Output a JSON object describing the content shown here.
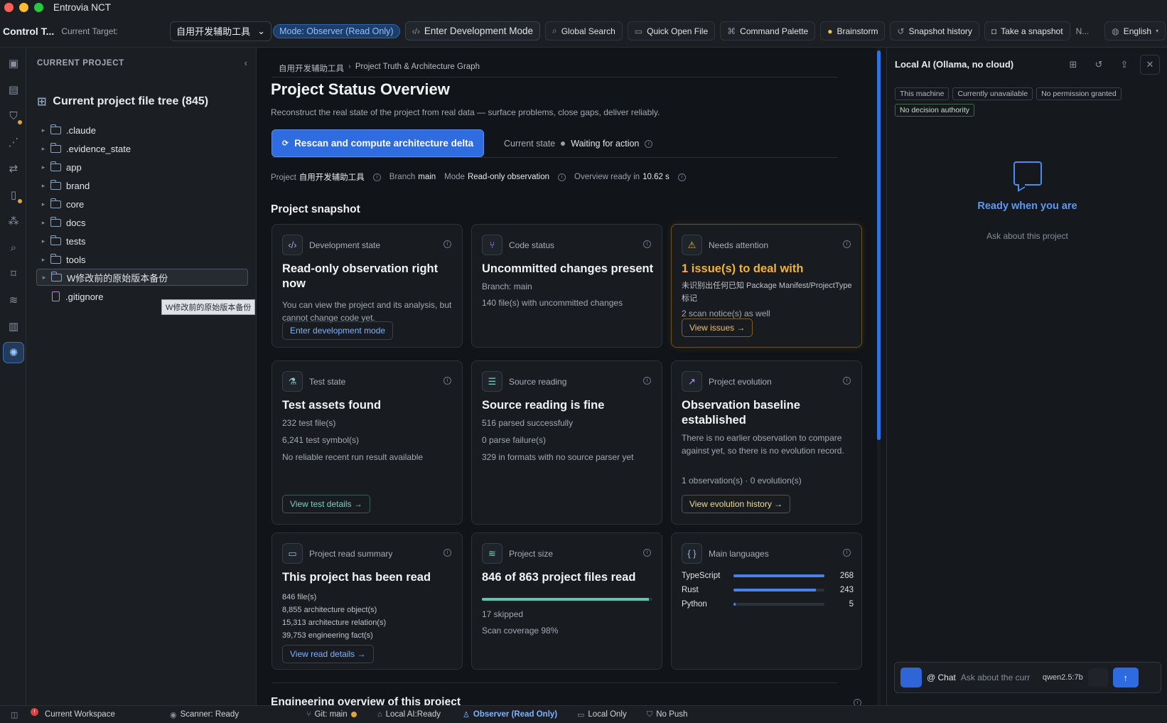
{
  "window": {
    "title": "Entrovia NCT"
  },
  "toolbar": {
    "brand": "Control T...",
    "target_label": "Current Target:",
    "target_value": "自用开发辅助工具",
    "mode_badge": "Mode: Observer (Read Only)",
    "dev_mode": "Enter Development Mode",
    "global_search": "Global Search",
    "quick_open": "Quick Open File",
    "command_palette": "Command Palette",
    "brainstorm": "Brainstorm",
    "snapshot_history": "Snapshot history",
    "take_snapshot": "Take a snapshot",
    "overflow": "N...",
    "language": "English"
  },
  "sidebar": {
    "heading": "CURRENT PROJECT",
    "tree_title": "Current project file tree (845)",
    "items": [
      {
        "label": ".claude",
        "kind": "folder"
      },
      {
        "label": ".evidence_state",
        "kind": "folder"
      },
      {
        "label": "app",
        "kind": "folder"
      },
      {
        "label": "brand",
        "kind": "folder"
      },
      {
        "label": "core",
        "kind": "folder"
      },
      {
        "label": "docs",
        "kind": "folder"
      },
      {
        "label": "tests",
        "kind": "folder"
      },
      {
        "label": "tools",
        "kind": "folder"
      },
      {
        "label": "W修改前的原始版本备份",
        "kind": "folder"
      },
      {
        "label": ".gitignore",
        "kind": "file"
      }
    ],
    "tooltip": "W修改前的原始版本备份"
  },
  "main": {
    "breadcrumb": [
      "自用开发辅助工具",
      "Project Truth & Architecture Graph"
    ],
    "title": "Project Status Overview",
    "subtitle": "Reconstruct the real state of the project from real data — surface problems, close gaps, deliver reliably.",
    "rescan_button": "Rescan and compute architecture delta",
    "state_label": "Current state",
    "state_value": "Waiting for action",
    "meta": {
      "project_label": "Project",
      "project_value": "自用开发辅助工具",
      "branch_label": "Branch",
      "branch_value": "main",
      "mode_label": "Mode",
      "mode_value": "Read-only observation",
      "ready_label": "Overview ready in",
      "ready_value": "10.62 s"
    },
    "snapshot_title": "Project snapshot",
    "engineering_title": "Engineering overview of this project",
    "cards": {
      "dev": {
        "label": "Development state",
        "title": "Read-only observation right now",
        "line1": "You can view the project and its analysis, but cannot change code yet.",
        "button": "Enter development mode"
      },
      "code": {
        "label": "Code status",
        "title": "Uncommitted changes present",
        "line1": "Branch: main",
        "line2": "140 file(s) with uncommitted changes"
      },
      "attention": {
        "label": "Needs attention",
        "title": "1 issue(s) to deal with",
        "line1": "未识别出任何已知 Package Manifest/ProjectType 标记",
        "line2": "2 scan notice(s) as well",
        "button": "View issues →"
      },
      "test": {
        "label": "Test state",
        "title": "Test assets found",
        "line1": "232 test file(s)",
        "line2": "6,241 test symbol(s)",
        "line3": "No reliable recent run result available",
        "button": "View test details →"
      },
      "source": {
        "label": "Source reading",
        "title": "Source reading is fine",
        "line1": "516 parsed successfully",
        "line2": "0 parse failure(s)",
        "line3": "329 in formats with no source parser yet"
      },
      "evolution": {
        "label": "Project evolution",
        "title": "Observation baseline established",
        "line1": "There is no earlier observation to compare against yet, so there is no evolution record.",
        "line2": "1 observation(s) · 0 evolution(s)",
        "button": "View evolution history →"
      },
      "read": {
        "label": "Project read summary",
        "title": "This project has been read",
        "line1": "846 file(s)",
        "line2": "8,855 architecture object(s)",
        "line3": "15,313 architecture relation(s)",
        "line4": "39,753 engineering fact(s)",
        "button": "View read details →"
      },
      "size": {
        "label": "Project size",
        "title": "846 of 863 project files read",
        "progress": 0.98,
        "line1": "17 skipped",
        "line2": "Scan coverage 98%"
      },
      "langs": {
        "label": "Main languages",
        "items": [
          {
            "name": "TypeScript",
            "value": "268",
            "fill": 1.0
          },
          {
            "name": "Rust",
            "value": "243",
            "fill": 0.91
          },
          {
            "name": "Python",
            "value": "5",
            "fill": 0.02
          }
        ]
      }
    }
  },
  "ai_panel": {
    "title": "Local AI (Ollama, no cloud)",
    "chips": [
      "This machine",
      "Currently unavailable",
      "No permission granted"
    ],
    "chip_green": "No decision authority",
    "ready": "Ready when you are",
    "ask": "Ask about this project",
    "chat_label": "@ Chat",
    "chat_placeholder": "Ask about the curr",
    "model": "qwen2.5:7b"
  },
  "statusbar": {
    "error_count": "!",
    "workspace": "Current Workspace",
    "scanner": "Scanner: Ready",
    "git": "Git: main",
    "ai": "Local AI:Ready",
    "observer": "Observer (Read Only)",
    "local": "Local Only",
    "push": "No Push"
  },
  "colors": {
    "accent": "#2e6ce0",
    "warning": "#f0b338",
    "teal": "#5ec5b0"
  }
}
